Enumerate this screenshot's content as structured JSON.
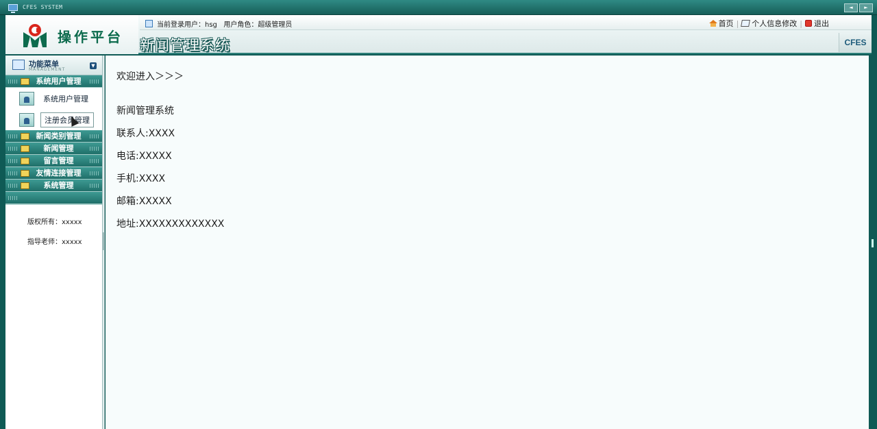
{
  "window": {
    "title": "CFES SYSTEM",
    "nav_prev": "◄",
    "nav_next": "►"
  },
  "header": {
    "logo_text": "操作平台",
    "system_title": "新闻管理系统",
    "badge": "CFES",
    "user_info": "当前登录用户：hsg   用户角色：超级管理员",
    "links": {
      "home": "首页",
      "profile": "个人信息修改",
      "logout": "退出"
    }
  },
  "sidebar": {
    "menu_title": "功能菜单",
    "menu_subtitle": "MANAGEMENT",
    "groups": [
      {
        "label": "系统用户管理"
      },
      {
        "label": "新闻类别管理"
      },
      {
        "label": "新闻管理"
      },
      {
        "label": "留言管理"
      },
      {
        "label": "友情连接管理"
      },
      {
        "label": "系统管理"
      }
    ],
    "sub_items": [
      {
        "label": "系统用户管理"
      },
      {
        "label": "注册会员管理"
      }
    ],
    "footer": {
      "copyright": "版权所有：xxxxx",
      "advisor": "指导老师：xxxxx"
    }
  },
  "main": {
    "welcome": "欢迎进入＞＞＞",
    "system_name": "新闻管理系统",
    "contact": "联系人:XXXX",
    "phone": "电话:XXXXX",
    "mobile": "手机:XXXX",
    "email": "邮箱:XXXXX",
    "address": "地址:XXXXXXXXXXXXX"
  }
}
